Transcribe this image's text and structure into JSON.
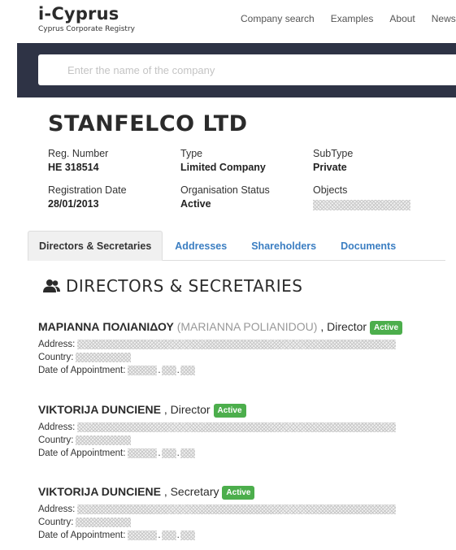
{
  "header": {
    "logo_title": "i-Cyprus",
    "logo_subtitle": "Cyprus Corporate Registry",
    "nav": [
      {
        "label": "Company search"
      },
      {
        "label": "Examples"
      },
      {
        "label": "About"
      },
      {
        "label": "News"
      }
    ]
  },
  "search": {
    "placeholder": "Enter the name of the company",
    "value": ""
  },
  "company": {
    "name": "STANFELCO LTD",
    "fields": {
      "reg_number_label": "Reg. Number",
      "reg_number_value": "HE 318514",
      "type_label": "Type",
      "type_value": "Limited Company",
      "subtype_label": "SubType",
      "subtype_value": "Private",
      "reg_date_label": "Registration Date",
      "reg_date_value": "28/01/2013",
      "status_label": "Organisation Status",
      "status_value": "Active",
      "objects_label": "Objects"
    }
  },
  "tabs": [
    {
      "label": "Directors & Secretaries",
      "active": true
    },
    {
      "label": "Addresses",
      "active": false
    },
    {
      "label": "Shareholders",
      "active": false
    },
    {
      "label": "Documents",
      "active": false
    }
  ],
  "section": {
    "title": "DIRECTORS & SECRETARIES",
    "icon": "users-icon"
  },
  "detail_labels": {
    "address": "Address:",
    "country": "Country:",
    "appointment": "Date of Appointment:",
    "date_sep": "."
  },
  "officers": [
    {
      "name": "ΜΑΡΙΑΝΝΑ ΠΟΛΙΑΝΙΔΟΥ",
      "latin": "(MARIANNA POLIANIDOU)",
      "role": ", Director",
      "status": "Active"
    },
    {
      "name": "VIKTORIJA DUNCIENE",
      "latin": "",
      "role": ", Director",
      "status": "Active"
    },
    {
      "name": "VIKTORIJA DUNCIENE",
      "latin": "",
      "role": ", Secretary",
      "status": "Active"
    }
  ],
  "colors": {
    "search_band": "#2e3345",
    "link": "#3b7ec2",
    "active_badge": "#4cae4c"
  }
}
